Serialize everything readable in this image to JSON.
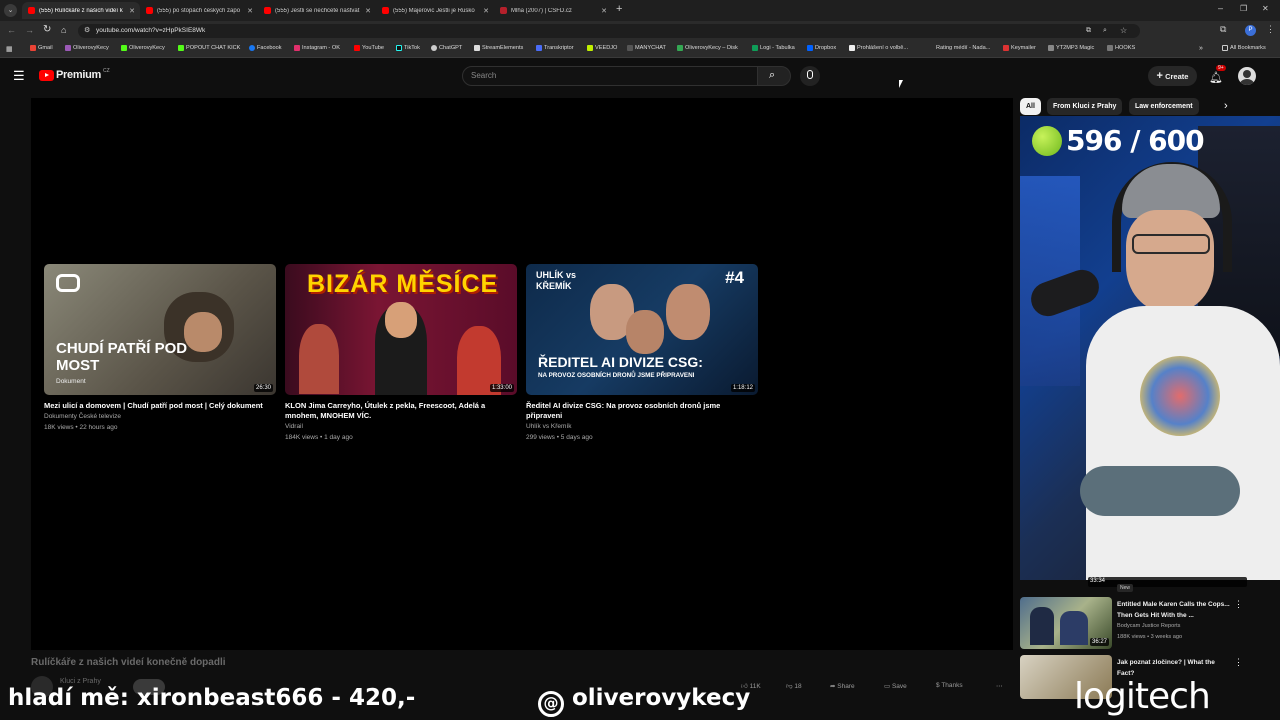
{
  "tabs": [
    {
      "title": "(555) Rulíčkáře z našich videí k",
      "active": true
    },
    {
      "title": "(555) po stopách českých zapo",
      "active": false
    },
    {
      "title": "(555) Jestli se nechcete naštvat",
      "active": false
    },
    {
      "title": "(555) Majerovic Jestli je Rusko",
      "active": false
    },
    {
      "title": "Mlha (2007) | ČSFD.cz",
      "active": false
    }
  ],
  "address": "youtube.com/watch?v=zHpPkSIE8Wk",
  "bookmarks": [
    "Gmail",
    "OliverovyKecy",
    "OliverovyKecy",
    "POPOUT CHAT KICK",
    "Facebook",
    "Instagram - OK",
    "YouTube",
    "TikTok",
    "ChatGPT",
    "StreamElements",
    "Transkriptor",
    "VEEDJO",
    "MANYCHAT",
    "OliverovyKecy – Disk",
    "Logi - Tabulka",
    "Dropbox",
    "Prohlášení o volbě...",
    "Rating médií - Nada...",
    "Keymailer",
    "YT2MP3 Magic",
    "HOOKS",
    "All Bookmarks"
  ],
  "youtube": {
    "logo": "Premium",
    "region": "CZ",
    "search_placeholder": "Search",
    "create_label": "Create",
    "notif_count": "9+"
  },
  "endscreen_videos": [
    {
      "title": "Mezi ulicí a domovem | Chudí patří pod most | Celý dokument",
      "channel": "Dokumenty České televize",
      "meta": "18K views • 22 hours ago",
      "duration": "26:30",
      "thumb_text": "CHUDÍ PATŘÍ POD MOST",
      "thumb_sub": "Dokument"
    },
    {
      "title": "KLON Jima Carreyho, Útulek z pekla, Freescoot, Adelá a mnohem, MNOHEM VÍC.",
      "channel": "Vidrail",
      "meta": "184K views • 1 day ago",
      "duration": "1:33:00",
      "thumb_text": "BIZÁR MĚSÍCE"
    },
    {
      "title": "Ředitel AI divize CSG: Na provoz osobních dronů jsme připraveni",
      "channel": "Uhlík vs Křemík",
      "meta": "299 views • 5 days ago",
      "duration": "1:18:12",
      "thumb_text": "ŘEDITEL AI DIVIZE CSG:",
      "thumb_sub": "NA PROVOZ OSOBNÍCH DRONŮ JSME PŘIPRAVENI",
      "thumb_tag": "#4",
      "thumb_top": "UHLÍK vs KŘEMÍK"
    }
  ],
  "chips": [
    "All",
    "From Kluci z Prahy",
    "Law enforcement"
  ],
  "stream_overlay": {
    "counter": "596 / 600"
  },
  "related": [
    {
      "duration": "33:34",
      "badge": "New"
    },
    {
      "title": "Entitled Male Karen Calls the Cops... Then Gets Hit With the ...",
      "channel": "Bodycam Justice Reports",
      "meta": "188K views • 3 weeks ago",
      "duration": "36:27"
    },
    {
      "title": "Jak poznat zločince? | What the Fact?"
    }
  ],
  "video": {
    "title": "Rulíčkáře z našich videí konečně dopadli",
    "channel": "Kluci z Prahy",
    "likes": "11K",
    "dislikes": "18",
    "share": "Share",
    "save": "Save",
    "thanks": "Thanks"
  },
  "overlay_texts": {
    "left": "hladí mě: xironbeast666 - 420,-",
    "center": "oliverovykecy",
    "right": "logitech"
  }
}
